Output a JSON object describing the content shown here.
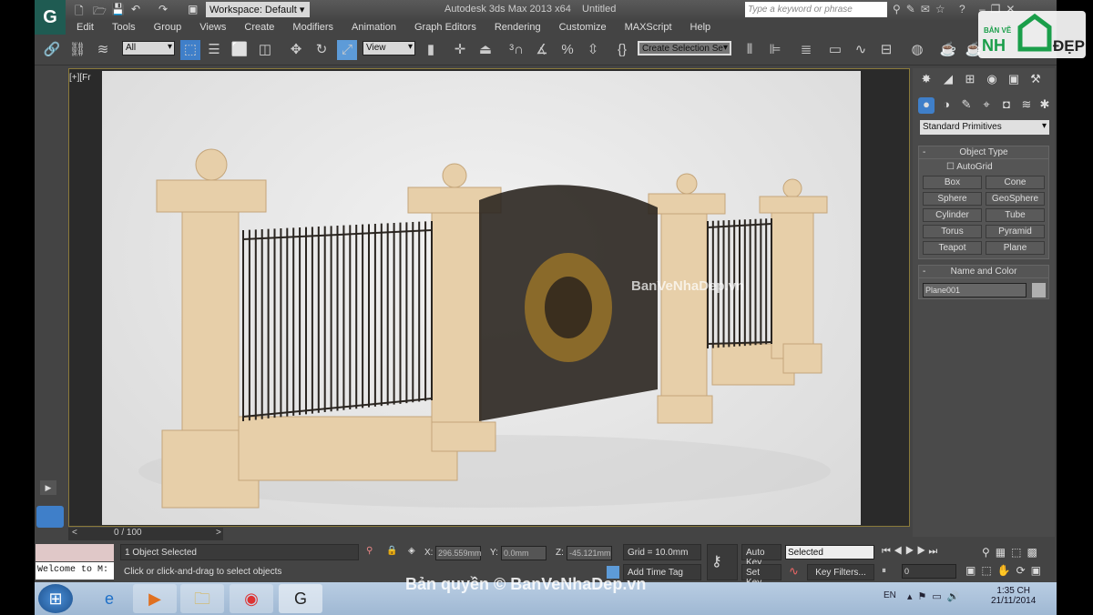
{
  "window": {
    "title": "Autodesk 3ds Max  2013 x64",
    "document": "Untitled",
    "workspace": "Workspace: Default",
    "search_placeholder": "Type a keyword or phrase"
  },
  "menu": [
    "Edit",
    "Tools",
    "Group",
    "Views",
    "Create",
    "Modifiers",
    "Animation",
    "Graph Editors",
    "Rendering",
    "Customize",
    "MAXScript",
    "Help"
  ],
  "toolbar": {
    "selection_filter": "All",
    "ref_coord": "View",
    "named_selection": "Create Selection Se"
  },
  "viewport": {
    "label": "[+][Fr",
    "watermark": "BanVeNhaDep.vn"
  },
  "command_panel": {
    "category": "Standard Primitives",
    "object_type": {
      "title": "Object Type",
      "autogrid": "AutoGrid",
      "buttons": [
        "Box",
        "Cone",
        "Sphere",
        "GeoSphere",
        "Cylinder",
        "Tube",
        "Torus",
        "Pyramid",
        "Teapot",
        "Plane"
      ]
    },
    "name_color": {
      "title": "Name and Color",
      "name": "Plane001",
      "color": "#b0b0b0"
    }
  },
  "timeline": {
    "frame": "0 / 100",
    "prev": "<",
    "next": ">"
  },
  "status": {
    "maxscript": "Welcome to M:",
    "selected": "1 Object Selected",
    "prompt": "Click or click-and-drag to select objects",
    "x_label": "X:",
    "x": "296.559mm",
    "y_label": "Y:",
    "y": "0.0mm",
    "z_label": "Z:",
    "z": "-45.121mm",
    "grid": "Grid = 10.0mm",
    "add_time_tag": "Add Time Tag",
    "auto_key": "Auto Key",
    "set_key": "Set Key",
    "key_mode": "Selected",
    "key_filters": "Key Filters...",
    "current_frame": "0"
  },
  "taskbar": {
    "lang": "EN",
    "time": "1:35 CH",
    "date": "21/11/2014"
  },
  "overlay": {
    "copyright": "Bản quyền © BanVeNhaDep.vn",
    "logo": "BẢN VẼ NHÀ ĐẸP"
  }
}
